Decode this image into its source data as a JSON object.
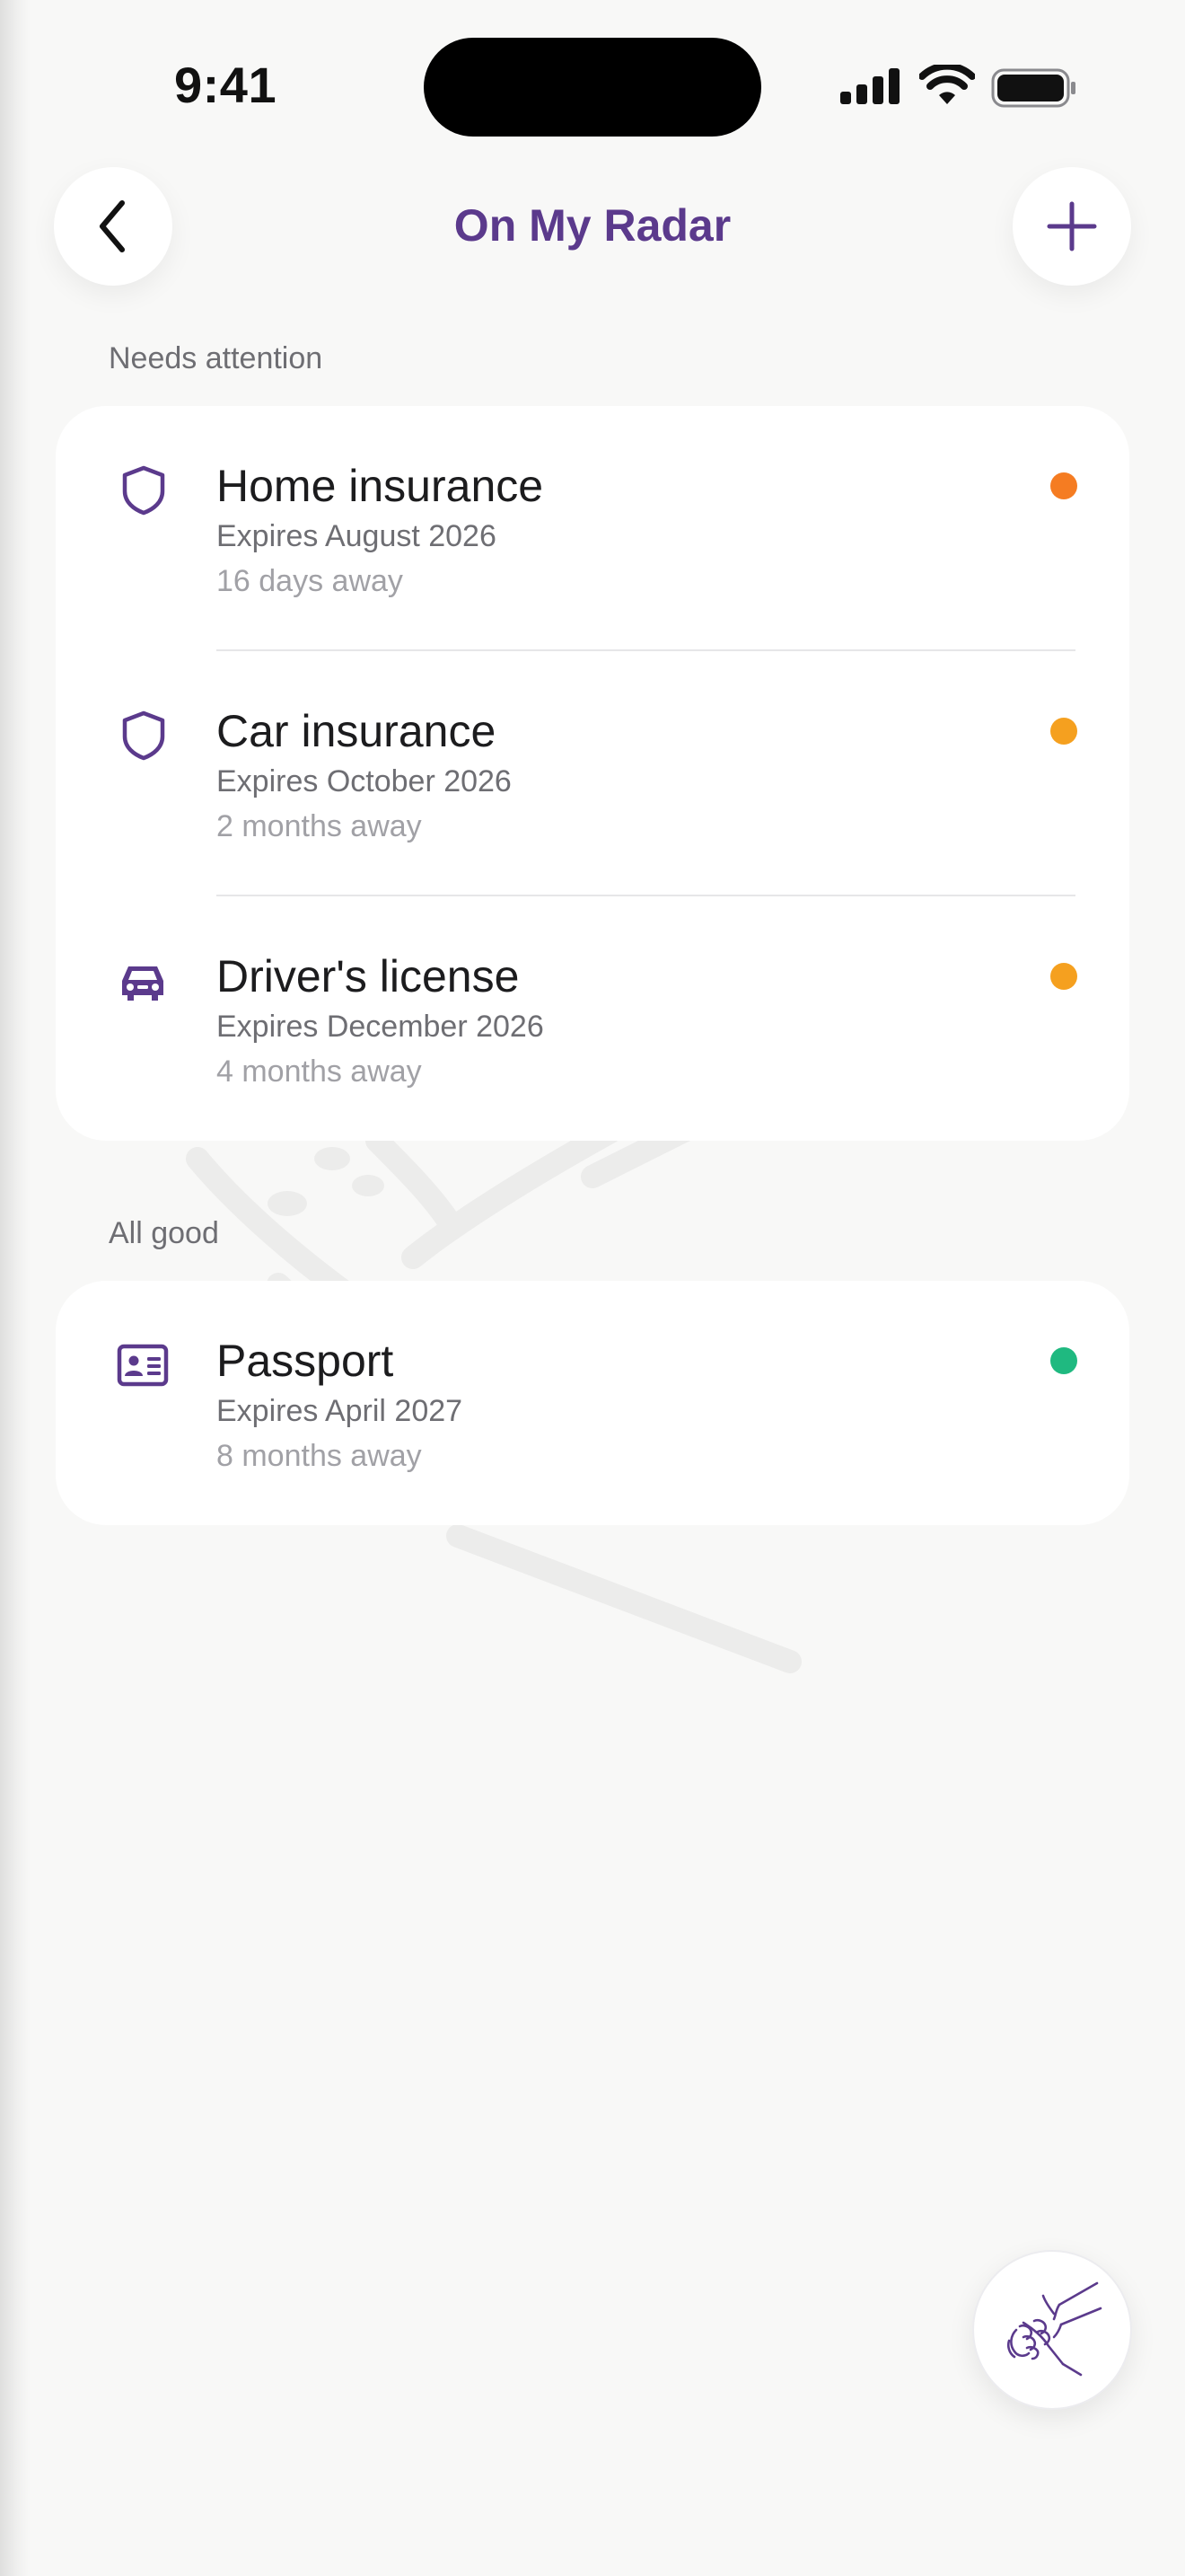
{
  "status_bar": {
    "time": "9:41"
  },
  "header": {
    "title": "On My Radar",
    "back_icon": "chevron-left-icon",
    "add_icon": "plus-icon"
  },
  "sections": [
    {
      "label": "Needs attention",
      "items": [
        {
          "title": "Home insurance",
          "subtitle": "Expires August 2026",
          "meta": "16 days away",
          "icon": "shield-icon",
          "status_color": "#f57c22"
        },
        {
          "title": "Car insurance",
          "subtitle": "Expires October 2026",
          "meta": "2 months away",
          "icon": "shield-icon",
          "status_color": "#f5a01f"
        },
        {
          "title": "Driver's license",
          "subtitle": "Expires December 2026",
          "meta": "4 months away",
          "icon": "car-icon",
          "status_color": "#f5a01f"
        }
      ]
    },
    {
      "label": "All good",
      "items": [
        {
          "title": "Passport",
          "subtitle": "Expires April 2027",
          "meta": "8 months away",
          "icon": "id-card-icon",
          "status_color": "#1fb980"
        }
      ]
    }
  ],
  "fab": {
    "icon": "handshake-icon"
  },
  "colors": {
    "accent": "#5b3a8c",
    "background": "#f8f8f7",
    "card": "#ffffff"
  }
}
